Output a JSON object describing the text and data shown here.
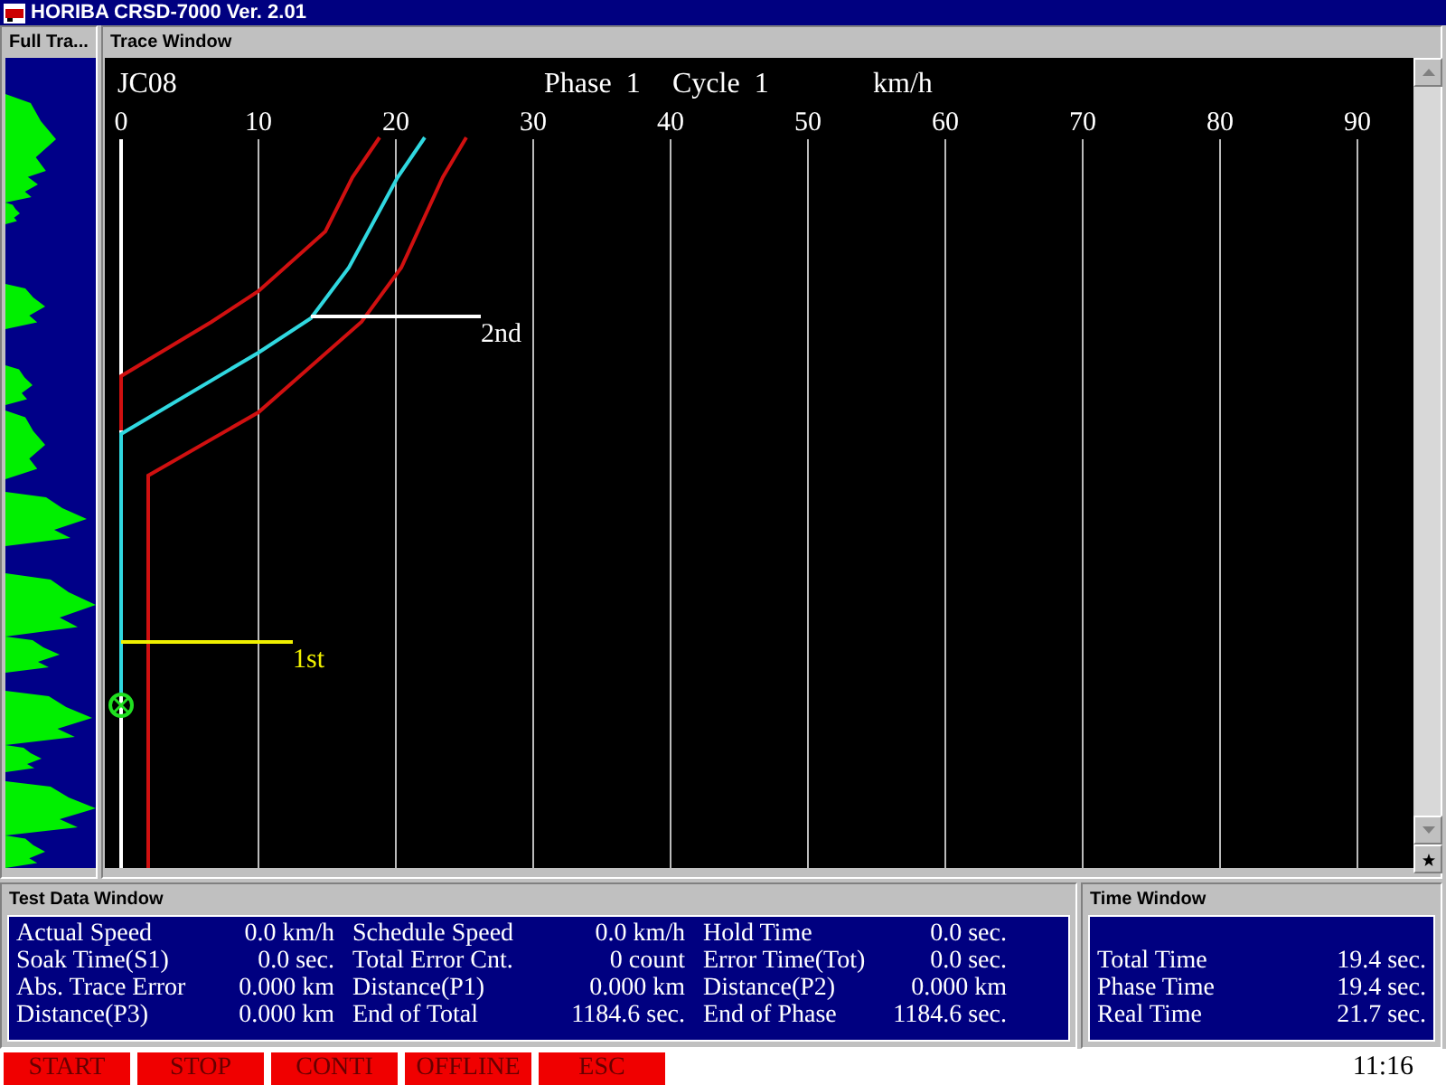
{
  "window": {
    "title": "HORIBA CRSD-7000 Ver. 2.01"
  },
  "full_trace": {
    "title": "Full Tra..."
  },
  "trace_window": {
    "title": "Trace Window",
    "mode": "JC08",
    "phase_label": "Phase",
    "phase": "1",
    "cycle_label": "Cycle",
    "cycle": "1",
    "unit": "km/h",
    "speed_ticks": [
      "0",
      "10",
      "20",
      "30",
      "40",
      "50",
      "60",
      "70",
      "80",
      "90"
    ],
    "markers": [
      {
        "label": "2nd",
        "color": "#ffffff"
      },
      {
        "label": "1st",
        "color": "#f0f000"
      }
    ]
  },
  "test_data": {
    "title": "Test Data Window",
    "rows": [
      [
        {
          "label": "Actual Speed",
          "value": "0.0 km/h"
        },
        {
          "label": "Schedule Speed",
          "value": "0.0 km/h"
        },
        {
          "label": "Hold Time",
          "value": "0.0 sec."
        }
      ],
      [
        {
          "label": "Soak Time(S1)",
          "value": "0.0 sec."
        },
        {
          "label": "Total Error Cnt.",
          "value": "0 count"
        },
        {
          "label": "Error Time(Tot)",
          "value": "0.0 sec."
        }
      ],
      [
        {
          "label": "Abs. Trace Error",
          "value": "0.000 km"
        },
        {
          "label": "Distance(P1)",
          "value": "0.000 km"
        },
        {
          "label": "Distance(P2)",
          "value": "0.000 km"
        }
      ],
      [
        {
          "label": "Distance(P3)",
          "value": "0.000 km"
        },
        {
          "label": "End of Total",
          "value": "1184.6 sec."
        },
        {
          "label": "End of Phase",
          "value": "1184.6 sec."
        }
      ]
    ]
  },
  "time_window": {
    "title": "Time Window",
    "rows": [
      {
        "label": "Total Time",
        "value": "19.4 sec."
      },
      {
        "label": "Phase Time",
        "value": "19.4 sec."
      },
      {
        "label": "Real Time",
        "value": "21.7 sec."
      }
    ]
  },
  "buttons": [
    "START",
    "STOP",
    "CONTI",
    "OFFLINE",
    "ESC"
  ],
  "clock": "11:16"
}
